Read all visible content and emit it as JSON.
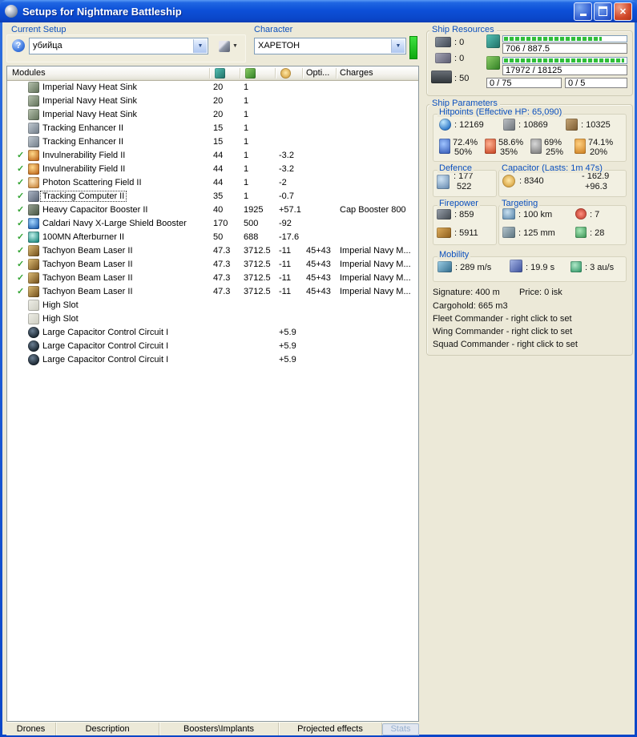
{
  "window": {
    "title": "Setups for Nightmare Battleship"
  },
  "icons": {
    "dropdown_arrow": "▼",
    "close_glyph": "✕",
    "help_glyph": "?",
    "check_glyph": "✓"
  },
  "current_setup": {
    "label": "Current Setup",
    "value": "убийца"
  },
  "character": {
    "label": "Character",
    "value": "ХАРЕТОН"
  },
  "modules_panel": {
    "header": "Modules",
    "columns": {
      "opti": "Opti...",
      "charges": "Charges"
    },
    "rows": [
      {
        "checked": false,
        "icon": "heat-sink",
        "name": "Imperial Navy Heat Sink",
        "cpu": "20",
        "pg": "1",
        "cap": "",
        "opti": "",
        "charges": ""
      },
      {
        "checked": false,
        "icon": "heat-sink",
        "name": "Imperial Navy Heat Sink",
        "cpu": "20",
        "pg": "1",
        "cap": "",
        "opti": "",
        "charges": ""
      },
      {
        "checked": false,
        "icon": "heat-sink",
        "name": "Imperial Navy Heat Sink",
        "cpu": "20",
        "pg": "1",
        "cap": "",
        "opti": "",
        "charges": ""
      },
      {
        "checked": false,
        "icon": "tracking-enhancer",
        "name": "Tracking Enhancer II",
        "cpu": "15",
        "pg": "1",
        "cap": "",
        "opti": "",
        "charges": ""
      },
      {
        "checked": false,
        "icon": "tracking-enhancer",
        "name": "Tracking Enhancer II",
        "cpu": "15",
        "pg": "1",
        "cap": "",
        "opti": "",
        "charges": ""
      },
      {
        "checked": true,
        "icon": "invulnerability-field",
        "name": "Invulnerability Field II",
        "cpu": "44",
        "pg": "1",
        "cap": "-3.2",
        "opti": "",
        "charges": ""
      },
      {
        "checked": true,
        "icon": "invulnerability-field",
        "name": "Invulnerability Field II",
        "cpu": "44",
        "pg": "1",
        "cap": "-3.2",
        "opti": "",
        "charges": ""
      },
      {
        "checked": true,
        "icon": "photon-scattering-field",
        "name": "Photon Scattering Field II",
        "cpu": "44",
        "pg": "1",
        "cap": "-2",
        "opti": "",
        "charges": ""
      },
      {
        "checked": true,
        "icon": "tracking-computer",
        "name": "Tracking Computer II",
        "cpu": "35",
        "pg": "1",
        "cap": "-0.7",
        "opti": "",
        "charges": "",
        "selected": true
      },
      {
        "checked": true,
        "icon": "cap-booster",
        "name": "Heavy Capacitor Booster II",
        "cpu": "40",
        "pg": "1925",
        "cap": "+57.1",
        "opti": "",
        "charges": "Cap Booster 800"
      },
      {
        "checked": true,
        "icon": "shield-booster",
        "name": "Caldari Navy X-Large Shield Booster",
        "cpu": "170",
        "pg": "500",
        "cap": "-92",
        "opti": "",
        "charges": ""
      },
      {
        "checked": true,
        "icon": "afterburner",
        "name": "100MN Afterburner II",
        "cpu": "50",
        "pg": "688",
        "cap": "-17.6",
        "opti": "",
        "charges": ""
      },
      {
        "checked": true,
        "icon": "beam-laser",
        "name": "Tachyon Beam Laser II",
        "cpu": "47.3",
        "pg": "3712.5",
        "cap": "-11",
        "opti": "45+43",
        "charges": "Imperial Navy M..."
      },
      {
        "checked": true,
        "icon": "beam-laser",
        "name": "Tachyon Beam Laser II",
        "cpu": "47.3",
        "pg": "3712.5",
        "cap": "-11",
        "opti": "45+43",
        "charges": "Imperial Navy M..."
      },
      {
        "checked": true,
        "icon": "beam-laser",
        "name": "Tachyon Beam Laser II",
        "cpu": "47.3",
        "pg": "3712.5",
        "cap": "-11",
        "opti": "45+43",
        "charges": "Imperial Navy M..."
      },
      {
        "checked": true,
        "icon": "beam-laser",
        "name": "Tachyon Beam Laser II",
        "cpu": "47.3",
        "pg": "3712.5",
        "cap": "-11",
        "opti": "45+43",
        "charges": "Imperial Navy M..."
      },
      {
        "checked": false,
        "icon": "high-slot",
        "name": "High Slot",
        "cpu": "",
        "pg": "",
        "cap": "",
        "opti": "",
        "charges": ""
      },
      {
        "checked": false,
        "icon": "high-slot",
        "name": "High Slot",
        "cpu": "",
        "pg": "",
        "cap": "",
        "opti": "",
        "charges": ""
      },
      {
        "checked": false,
        "icon": "rig",
        "name": "Large Capacitor Control Circuit I",
        "cpu": "",
        "pg": "",
        "cap": "+5.9",
        "opti": "",
        "charges": ""
      },
      {
        "checked": false,
        "icon": "rig",
        "name": "Large Capacitor Control Circuit I",
        "cpu": "",
        "pg": "",
        "cap": "+5.9",
        "opti": "",
        "charges": ""
      },
      {
        "checked": false,
        "icon": "rig",
        "name": "Large Capacitor Control Circuit I",
        "cpu": "",
        "pg": "",
        "cap": "+5.9",
        "opti": "",
        "charges": ""
      }
    ]
  },
  "ship_resources": {
    "label": "Ship Resources",
    "turrets": ": 0",
    "launchers": ": 0",
    "calibration": ": 50",
    "cpu": "706 / 887.5",
    "powergrid": "17972 / 18125",
    "drone_bay": "0 / 75",
    "drones": "0 / 5"
  },
  "ship_parameters": {
    "label": "Ship Parameters",
    "hitpoints": {
      "label": "Hitpoints (Effective HP: 65,090)",
      "shield": ": 12169",
      "armor": ": 10869",
      "hull": ": 10325",
      "resists": [
        {
          "shield": "72.4%",
          "armor": "50%"
        },
        {
          "shield": "58.6%",
          "armor": "35%"
        },
        {
          "shield": "69%",
          "armor": "25%"
        },
        {
          "shield": "74.1%",
          "armor": "20%"
        }
      ]
    },
    "defence": {
      "label": "Defence",
      "line1": ": 177",
      "line2": "522"
    },
    "capacitor": {
      "label": "Capacitor (Lasts: 1m 47s)",
      "amount": ": 8340",
      "peak": "- 162.9",
      "recharge": "+96.3"
    },
    "firepower": {
      "label": "Firepower",
      "dps": ": 859",
      "volley": ": 5911"
    },
    "targeting": {
      "label": "Targeting",
      "range": ": 100 km",
      "max_targets": ": 7",
      "scan_resolution": ": 125 mm",
      "sensor_strength": ": 28"
    },
    "mobility": {
      "label": "Mobility",
      "speed": ": 289 m/s",
      "align_time": ": 19.9 s",
      "warp_speed": ": 3 au/s"
    },
    "signature": "Signature: 400 m",
    "price": "Price: 0 isk",
    "cargohold": "Cargohold: 665 m3",
    "fleet_commander": "Fleet Commander - right click to set",
    "wing_commander": "Wing Commander - right click to set",
    "squad_commander": "Squad Commander - right click to set"
  },
  "bottom_tabs": [
    {
      "label": "Drones"
    },
    {
      "label": "Description"
    },
    {
      "label": "Boosters\\Implants"
    },
    {
      "label": "Projected effects"
    },
    {
      "label": "Stats"
    }
  ]
}
